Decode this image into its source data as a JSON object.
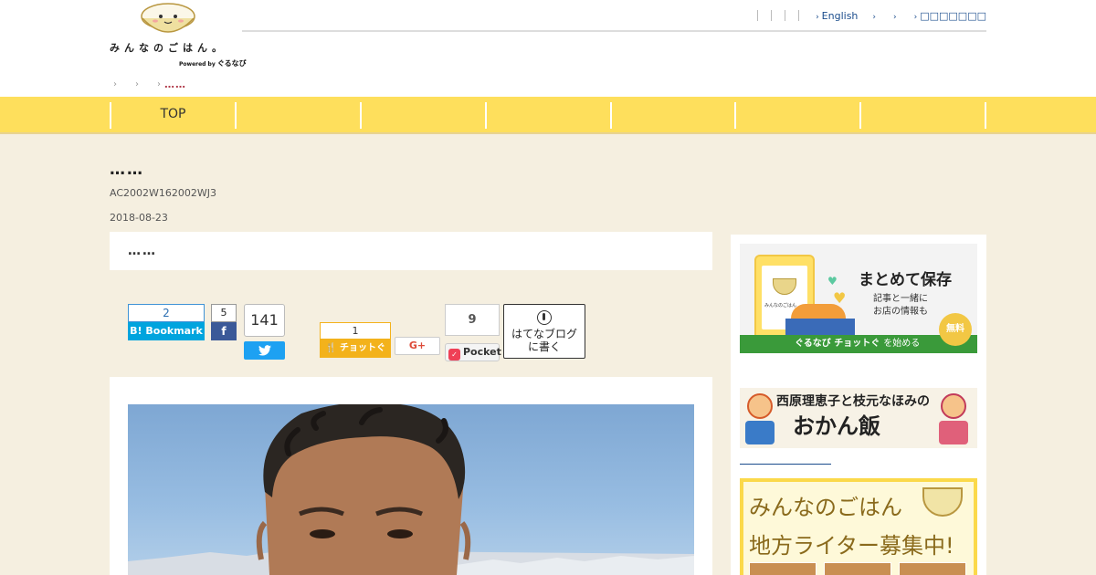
{
  "header": {
    "logo": {
      "text": "みんなのごはん。",
      "powered_by": "Powered by",
      "brand": "ぐるなび"
    },
    "util_nav": [
      {
        "label": "English"
      },
      {
        "label": ""
      },
      {
        "label": ""
      },
      {
        "label": "□□□□□□□"
      }
    ],
    "breadcrumb": {
      "current": "……"
    }
  },
  "gnav": {
    "items": [
      "TOP",
      "",
      "",
      "",
      "",
      "",
      ""
    ]
  },
  "article": {
    "title": "……",
    "code": "AC2002W162002WJ3",
    "date": "2018-08-23",
    "heading": "……"
  },
  "share": {
    "hatena": {
      "count": "2",
      "label": "B! Bookmark"
    },
    "facebook": {
      "count": "5",
      "label": "f"
    },
    "twitter": {
      "count": "141"
    },
    "chotto": {
      "count": "1",
      "label": "チョットぐ"
    },
    "gplus": {
      "label": "G+"
    },
    "pocket": {
      "count": "9",
      "label": "Pocket"
    },
    "hatena_blog": {
      "line1": "はてなブログ",
      "line2": "に書く"
    }
  },
  "sidebar": {
    "banner_chotto": {
      "phone_caption": "みんなのごはん",
      "title": "まとめて保存",
      "sub1": "記事と一緒に",
      "sub2": "お店の情報も",
      "badge": "無料",
      "strip_brand": "ぐるなび チョットぐ",
      "strip_action": "を始める"
    },
    "banner_okan": {
      "line1": "西原理恵子と枝元なほみの",
      "line2": "おかん飯"
    },
    "banner_writer": {
      "line1": "みんなのごはん",
      "line2": "地方ライター募集中!"
    }
  },
  "colors": {
    "nav_yellow": "#fedf5c",
    "page_bg": "#f5efe0",
    "link_blue": "#1a4c8c",
    "hatena_blue": "#00a4de",
    "facebook_blue": "#3b5998",
    "twitter_blue": "#1da1f2",
    "chotto_orange": "#f3b21b",
    "pocket_red": "#ef4056"
  }
}
